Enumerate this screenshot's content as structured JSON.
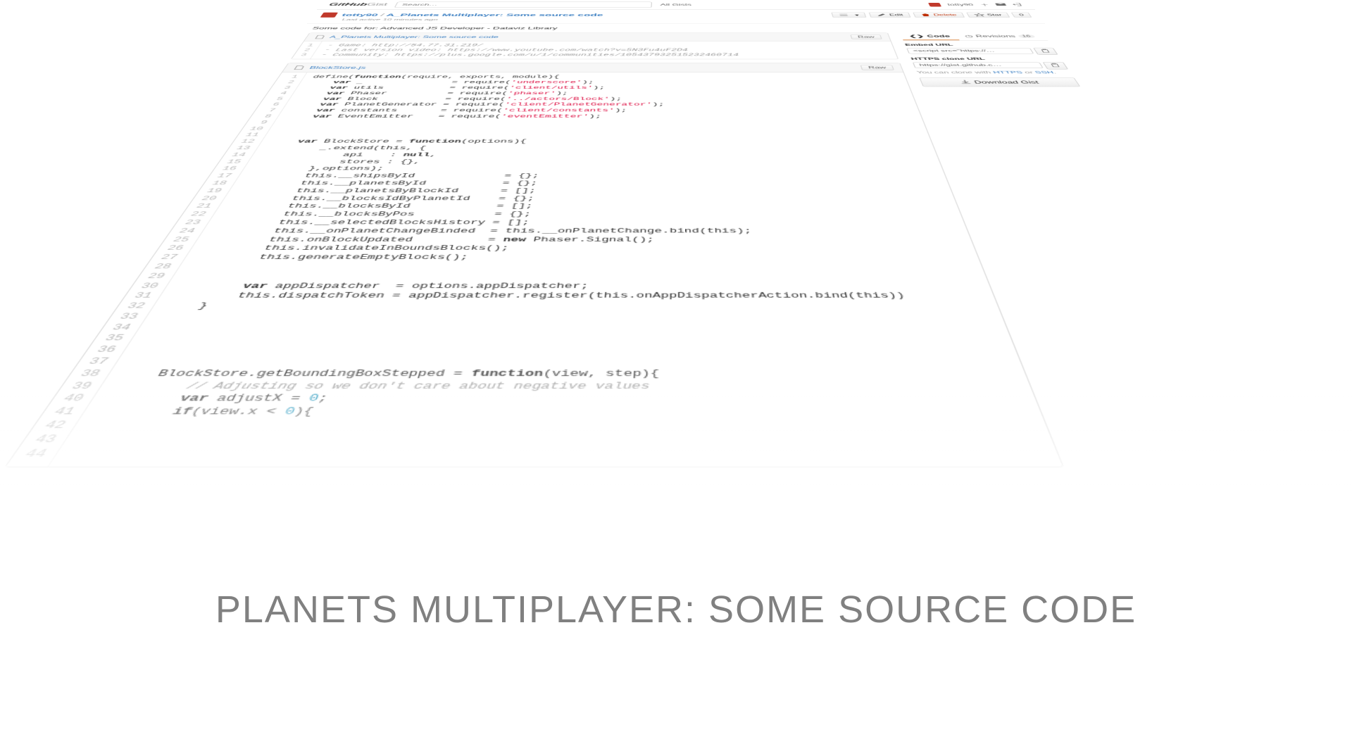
{
  "header": {
    "logo_main": "GitHub",
    "logo_sub": "Gist",
    "search_placeholder": "Search…",
    "nav_all_gists": "All Gists",
    "username": "totty90"
  },
  "title": {
    "owner": "totty90",
    "name": "A_Planets Multiplayer: Some source code",
    "meta": "Last active 10 minutes ago"
  },
  "actions": {
    "menu_btn": "",
    "edit": "Edit",
    "delete": "Delete",
    "star": "Star",
    "count": "0"
  },
  "description": "Some code for: Advanced JS Developer - Dataviz Library",
  "file1": {
    "name": "A_Planets Multiplayer: Some source code",
    "raw": "Raw",
    "lines": "1\n2\n3",
    "l1": "- Game: http://54.77.31.219/",
    "l2": "- Last version video: https://www.youtube.com/watch?v=5N3Fu4uF2D4",
    "l3": "- Community: https://plus.google.com/u/1/communities/105437932515232460714"
  },
  "file2": {
    "name": "BlockStore.js",
    "raw": "Raw",
    "lines": "1\n2\n3\n4\n5\n6\n7\n8\n9\n10\n11\n12\n13\n14\n15\n16\n17\n18\n19\n20\n21\n22\n23\n24\n25\n26\n27\n28\n29\n30\n31\n32\n33\n34\n35\n36\n37\n38\n39\n40\n41\n42\n43\n44"
  },
  "code": {
    "l1a": "define(",
    "l1b": "function",
    "l1c": "(require, exports, module){",
    "l2a": "    var",
    "l2b": " _               = require(",
    "l2c": "'underscore'",
    "l2d": ");",
    "l3a": "    var",
    "l3b": " utils           = require(",
    "l3c": "'client/utils'",
    "l3d": ");",
    "l4a": "    var",
    "l4b": " Phaser          = require(",
    "l4c": "'phaser'",
    "l4d": ");",
    "l5a": "    var",
    "l5b": " Block           = require(",
    "l5c": "'../actors/Block'",
    "l5d": ");",
    "l6a": "    var",
    "l6b": " PlanetGenerator = require(",
    "l6c": "'client/PlanetGenerator'",
    "l6d": ");",
    "l7a": "    var",
    "l7b": " constants       = require(",
    "l7c": "'client/constants'",
    "l7d": ");",
    "l8a": "    var",
    "l8b": " EventEmitter    = require(",
    "l8c": "'eventEmitter'",
    "l8d": ");",
    "l13a": "    var",
    "l13b": " BlockStore = ",
    "l13c": "function",
    "l13d": "(options){",
    "l14": "        _.extend(this, {",
    "l15a": "            api    : ",
    "l15b": "null",
    "l15c": ",",
    "l16": "            stores : {},",
    "l17": "        },options);",
    "l18": "        this.__shipsById             = {};",
    "l19": "        this.__planetsById           = {};",
    "l20": "        this.__planetsByBlockId      = [];",
    "l21": "        this.__blocksIdByPlanetId    = {};",
    "l22": "        this.__blocksById            = [];",
    "l23": "        this.__blocksByPos           = {};",
    "l24": "        this.__selectedBlocksHistory = [];",
    "l25": "        this.__onPlanetChangeBinded  = this.__onPlanetChange.bind(this);",
    "l26a": "        this.onBlockUpdated          = ",
    "l26b": "new",
    "l26c": " Phaser.Signal();",
    "l27": "        this.invalidateInBoundsBlocks();",
    "l28": "        this.generateEmptyBlocks();",
    "l31a": "        var",
    "l31b": " appDispatcher  = options.appDispatcher;",
    "l32": "        this.dispatchToken = appDispatcher.register(this.onAppDispatcherAction.bind(this))",
    "l33": "    }",
    "l40a": "    BlockStore.getBoundingBoxStepped = ",
    "l40b": "function",
    "l40c": "(view, step){",
    "l41": "        // Adjusting so we don't care about negative values",
    "l42a": "        var",
    "l42b": " adjustX = ",
    "l42c": "0",
    "l42d": ";",
    "l43a": "        if",
    "l43b": "(view.x < ",
    "l43c": "0",
    "l43d": "){"
  },
  "sidebar": {
    "tab_code": "Code",
    "tab_revisions": "Revisions",
    "rev_count": "16",
    "embed_label": "Embed URL",
    "embed_value": "<script src=\"https://…",
    "clone_label": "HTTPS clone URL",
    "clone_value": "https://gist.github.c…",
    "clone_note_pre": "You can clone with ",
    "clone_note_https": "HTTPS",
    "clone_note_mid": " or ",
    "clone_note_ssh": "SSH",
    "clone_note_end": ".",
    "download": "Download Gist"
  },
  "caption": "PLANETS MULTIPLAYER: SOME SOURCE CODE"
}
